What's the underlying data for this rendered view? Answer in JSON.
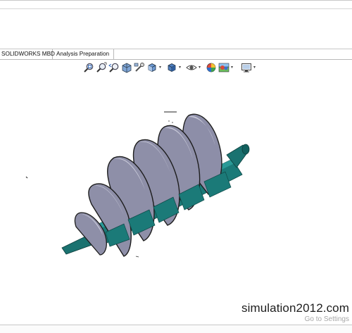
{
  "tabs": [
    {
      "label": "SOLIDWORKS MBD",
      "active": false
    },
    {
      "label": "Analysis Preparation",
      "active": false
    }
  ],
  "heads_up_toolbar": {
    "icons": [
      "zoom-to-fit-icon",
      "zoom-to-area-icon",
      "previous-view-icon",
      "section-view-icon",
      "dynamic-annotation-views-icon",
      "view-orientation-icon",
      "display-style-icon",
      "hide-show-items-icon",
      "edit-appearance-icon",
      "apply-scene-icon",
      "view-settings-icon"
    ]
  },
  "model": {
    "name": "screw-conveyor-auger",
    "colors": {
      "shaft": "#1a7270",
      "flight": "#8e8fa8",
      "flight_light": "#c9cad9",
      "edge": "#1d1d1d"
    }
  },
  "watermark": {
    "text": "simulation2012.com"
  },
  "windows_notice": {
    "text": "Go to Settings"
  }
}
